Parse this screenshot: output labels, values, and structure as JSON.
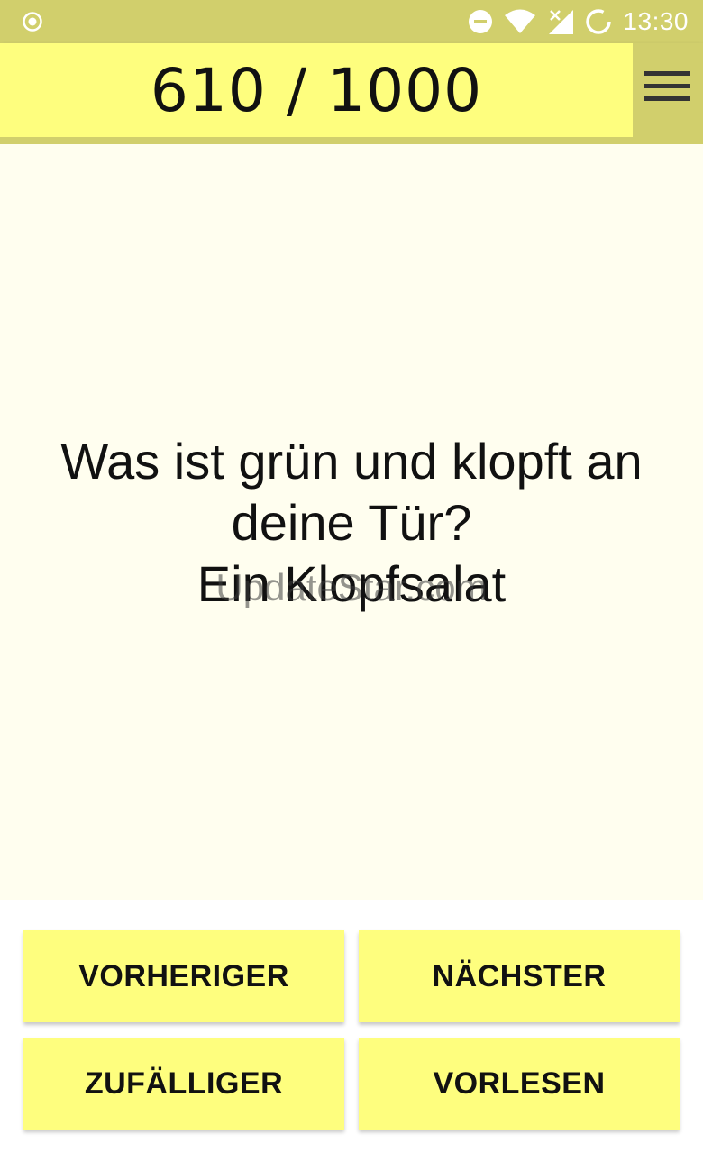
{
  "status_bar": {
    "time": "13:30",
    "icons": [
      "radio-icon",
      "do-not-disturb-icon",
      "wifi-icon",
      "signal-icon",
      "sync-icon"
    ]
  },
  "app_bar": {
    "counter": "610 / 1000",
    "menu_icon": "hamburger-menu-icon"
  },
  "joke": {
    "question_line1": "Was ist grün und klopft an",
    "question_line2": "deine Tür?",
    "answer": "Ein Klopfsalat"
  },
  "watermark": "UpdateStar.com",
  "buttons": {
    "previous": "VORHERIGER",
    "next": "NÄCHSTER",
    "random": "ZUFÄLLIGER",
    "read_aloud": "VORLESEN"
  },
  "colors": {
    "status_bar": "#d1cf6c",
    "accent_yellow": "#fefe7e",
    "content_bg": "#fffeef"
  }
}
